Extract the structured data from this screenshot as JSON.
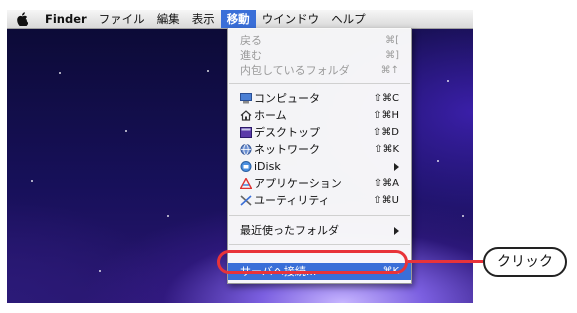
{
  "menubar": {
    "apple_icon": "apple-logo",
    "items": [
      {
        "label": "Finder"
      },
      {
        "label": "ファイル"
      },
      {
        "label": "編集"
      },
      {
        "label": "表示"
      },
      {
        "label": "移動"
      },
      {
        "label": "ウインドウ"
      },
      {
        "label": "ヘルプ"
      }
    ],
    "active_index": 4
  },
  "go_menu": {
    "history": [
      {
        "label": "戻る",
        "shortcut": "⌘["
      },
      {
        "label": "進む",
        "shortcut": "⌘]"
      },
      {
        "label": "内包しているフォルダ",
        "shortcut": "⌘↑"
      }
    ],
    "places": [
      {
        "label": "コンピュータ",
        "shortcut": "⇧⌘C",
        "icon": "computer-icon"
      },
      {
        "label": "ホーム",
        "shortcut": "⇧⌘H",
        "icon": "home-icon"
      },
      {
        "label": "デスクトップ",
        "shortcut": "⇧⌘D",
        "icon": "desktop-icon"
      },
      {
        "label": "ネットワーク",
        "shortcut": "⇧⌘K",
        "icon": "network-icon"
      },
      {
        "label": "iDisk",
        "shortcut": "",
        "icon": "idisk-icon"
      },
      {
        "label": "アプリケーション",
        "shortcut": "⇧⌘A",
        "icon": "applications-icon"
      },
      {
        "label": "ユーティリティ",
        "shortcut": "⇧⌘U",
        "icon": "utilities-icon"
      }
    ],
    "recent": {
      "label": "最近使ったフォルダ"
    },
    "connect": {
      "label": "サーバへ接続...",
      "shortcut": "⌘K"
    }
  },
  "annotation": {
    "callout_label": "クリック",
    "highlight_color": "#e8333a"
  },
  "colors": {
    "selection": "#3a6fd8"
  }
}
